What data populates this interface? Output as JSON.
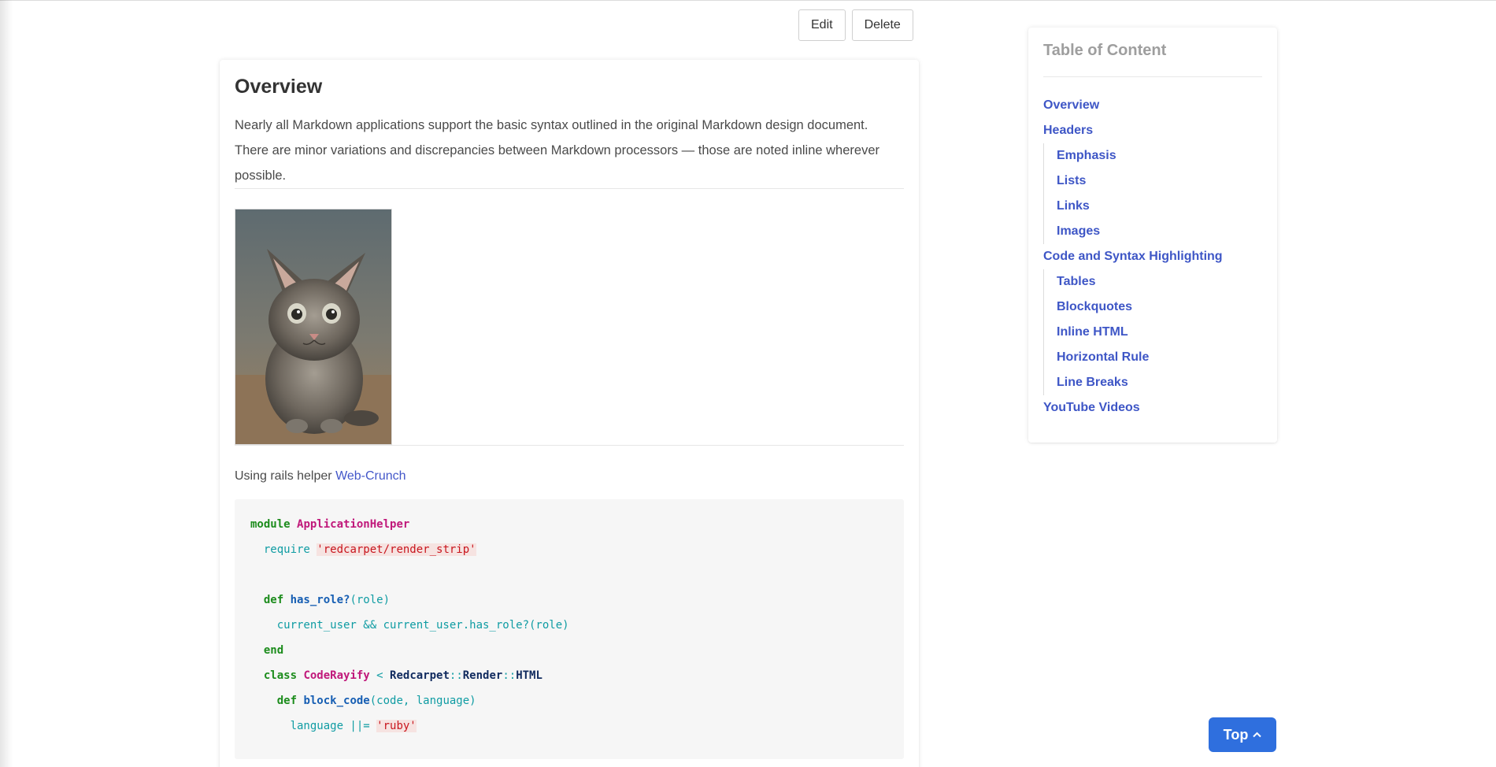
{
  "actions": {
    "edit_label": "Edit",
    "delete_label": "Delete"
  },
  "article": {
    "title": "Overview",
    "intro": "Nearly all Markdown applications support the basic syntax outlined in the original Markdown design document. There are minor variations and discrepancies between Markdown processors — those are noted inline wherever possible.",
    "image_alt": "kitten photo",
    "helper_text": "Using rails helper ",
    "helper_link": "Web-Crunch"
  },
  "code": {
    "l1a": "module ",
    "l1b": "ApplicationHelper",
    "l2a": "  require ",
    "l2b": "'redcarpet/render_strip'",
    "l4a": "  def ",
    "l4b": "has_role?",
    "l4c": "(role)",
    "l5": "    current_user && current_user.has_role?(role)",
    "l6": "  end",
    "l7a": "  class ",
    "l7b": "CodeRayify",
    "l7c": " < ",
    "l7d": "Redcarpet",
    "l7e": "::",
    "l7f": "Render",
    "l7g": "::",
    "l7h": "HTML",
    "l8a": "    def ",
    "l8b": "block_code",
    "l8c": "(code, language)",
    "l9a": "      language ||= ",
    "l9b": "'ruby'"
  },
  "toc": {
    "title": "Table of Content",
    "items": [
      "Overview",
      "Headers",
      "Emphasis",
      "Lists",
      "Links",
      "Images",
      "Code and Syntax Highlighting",
      "Tables",
      "Blockquotes",
      "Inline HTML",
      "Horizontal Rule",
      "Line Breaks",
      "YouTube Videos"
    ]
  },
  "top_button": {
    "label": "Top",
    "icon": "chevron-up-icon"
  }
}
